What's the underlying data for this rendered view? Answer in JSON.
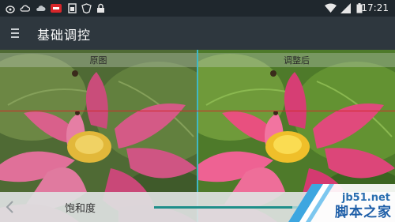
{
  "status_bar": {
    "time": "17:21",
    "icons": [
      "weibo-icon",
      "cloud-icon",
      "app-badge-icon",
      "sim-icon",
      "shield-icon",
      "lock-icon",
      "wifi-icon",
      "signal-icon",
      "battery-icon"
    ]
  },
  "app_bar": {
    "title": "基础调控",
    "menu_icon": "menu-icon"
  },
  "panels": {
    "left_label": "原图",
    "right_label": "调整后"
  },
  "bottom": {
    "param_label": "饱和度",
    "slider_level_percent": 88
  },
  "watermark": {
    "url": "jb51.net",
    "name": "脚本之家"
  },
  "colors": {
    "accent": "#3fb8c6",
    "slider": "#1f8f8a",
    "guide_line": "#d22a2a"
  }
}
